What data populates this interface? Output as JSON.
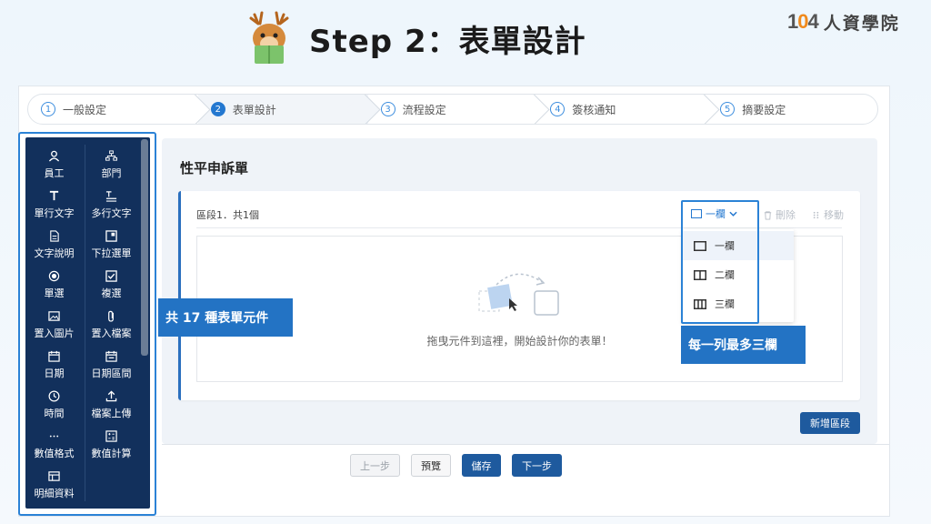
{
  "header": {
    "title": "Step 2：表單設計",
    "brand_num_a": "1",
    "brand_num_b": "0",
    "brand_num_c": "4",
    "brand_text": "人資學院"
  },
  "steps": [
    {
      "num": "1",
      "label": "一般設定"
    },
    {
      "num": "2",
      "label": "表單設計"
    },
    {
      "num": "3",
      "label": "流程設定"
    },
    {
      "num": "4",
      "label": "簽核通知"
    },
    {
      "num": "5",
      "label": "摘要設定"
    }
  ],
  "palette": [
    {
      "label": "員工",
      "icon": "user-icon"
    },
    {
      "label": "部門",
      "icon": "org-chart-icon"
    },
    {
      "label": "單行文字",
      "icon": "text-icon"
    },
    {
      "label": "多行文字",
      "icon": "multiline-text-icon"
    },
    {
      "label": "文字說明",
      "icon": "document-icon"
    },
    {
      "label": "下拉選單",
      "icon": "dropdown-icon"
    },
    {
      "label": "單選",
      "icon": "radio-icon"
    },
    {
      "label": "複選",
      "icon": "checkbox-icon"
    },
    {
      "label": "置入圖片",
      "icon": "image-icon"
    },
    {
      "label": "置入檔案",
      "icon": "paperclip-icon"
    },
    {
      "label": "日期",
      "icon": "calendar-icon"
    },
    {
      "label": "日期區間",
      "icon": "calendar-range-icon"
    },
    {
      "label": "時間",
      "icon": "clock-icon"
    },
    {
      "label": "檔案上傳",
      "icon": "upload-icon"
    },
    {
      "label": "數值格式",
      "icon": "number-format-icon"
    },
    {
      "label": "數值計算",
      "icon": "calculator-icon"
    },
    {
      "label": "明細資料",
      "icon": "table-icon"
    }
  ],
  "form": {
    "title": "性平申訴單",
    "section_label": "區段1．共1個",
    "drop_hint": "拖曳元件到這裡，開始設計你的表單！",
    "delete_label": "刪除",
    "move_label": "移動"
  },
  "columns": {
    "current": "一欄",
    "options": [
      "一欄",
      "二欄",
      "三欄"
    ]
  },
  "callouts": {
    "components": "共 17 種表單元件",
    "columns": "每一列最多三欄"
  },
  "buttons": {
    "add_section": "新增區段",
    "prev": "上一步",
    "preview": "預覽",
    "save": "儲存",
    "next": "下一步"
  },
  "colors": {
    "sidebar_bg": "#12305c",
    "accent": "#2478d0",
    "callout": "#2373c4",
    "primary_button": "#1e5a9e",
    "brand_orange": "#f08a1c"
  }
}
